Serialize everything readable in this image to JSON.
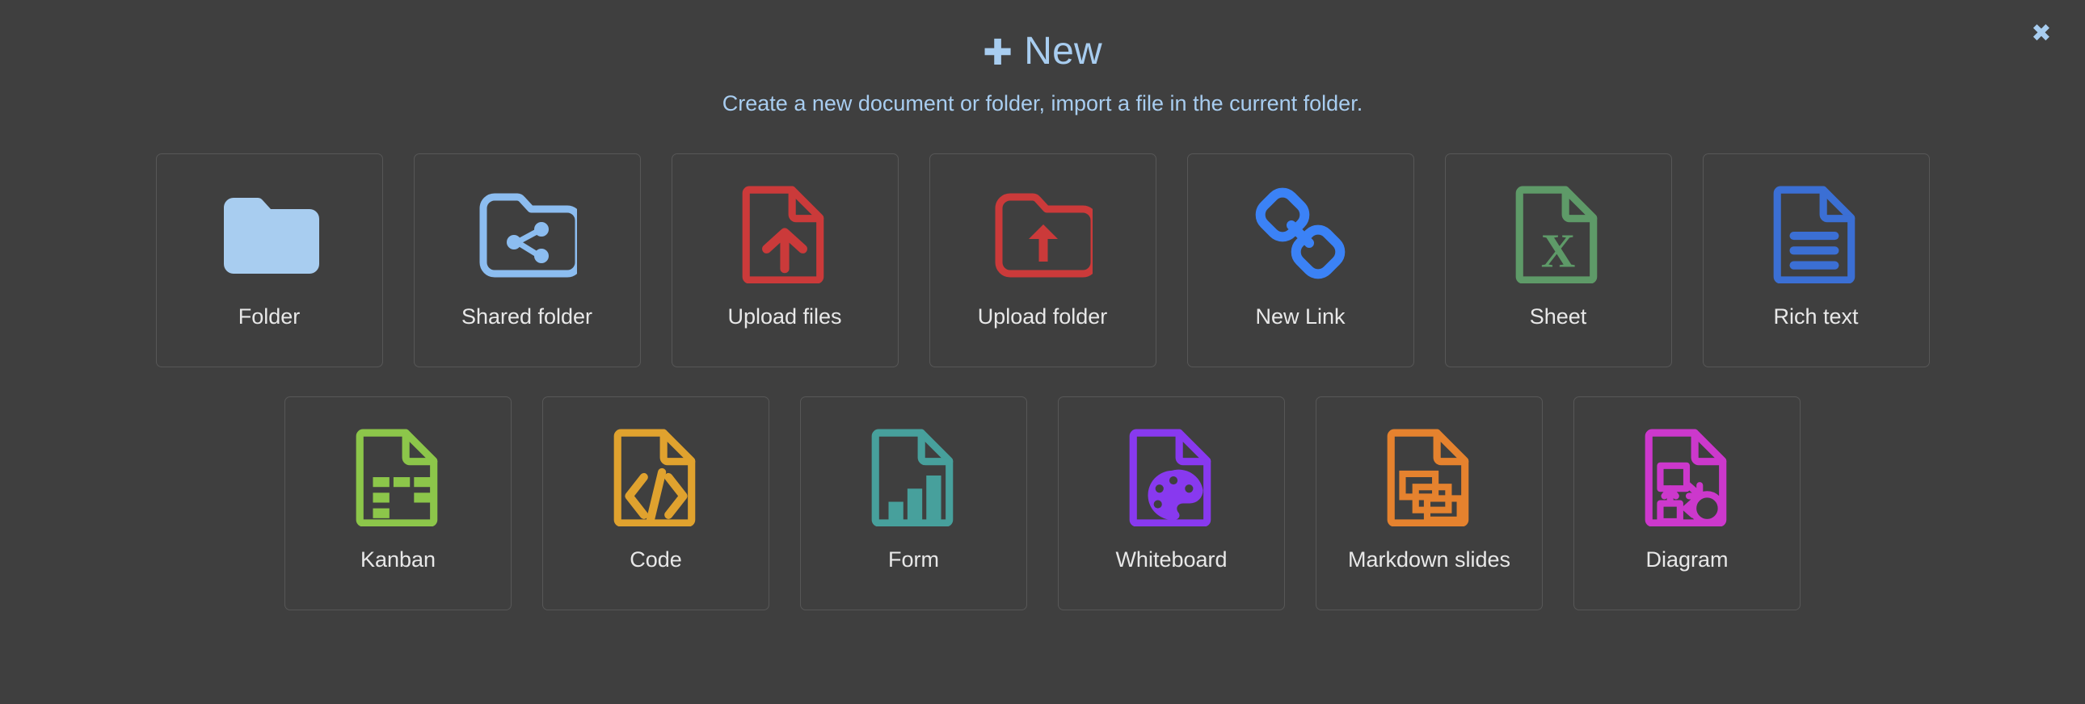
{
  "dialog": {
    "title": "New",
    "title_prefix_icon": "plus-icon",
    "subtitle": "Create a new document or folder, import a file in the current folder.",
    "close_icon": "close-icon",
    "close_label": "✖",
    "plus_glyph": "✚",
    "accent_color": "#a8cdf0",
    "background_color": "#3f3f3f",
    "tile_border_color": "#575757",
    "label_color": "#e8e8e8"
  },
  "rows": [
    {
      "name": "row-1",
      "tiles": [
        {
          "label": "Folder",
          "icon": "folder-icon",
          "color": "#a8cdf0"
        },
        {
          "label": "Shared folder",
          "icon": "shared-folder-icon",
          "color": "#8cbdf0"
        },
        {
          "label": "Upload files",
          "icon": "upload-file-icon",
          "color": "#cb3a3a"
        },
        {
          "label": "Upload folder",
          "icon": "upload-folder-icon",
          "color": "#cb3a3a"
        },
        {
          "label": "New Link",
          "icon": "link-icon",
          "color": "#3b82f6"
        },
        {
          "label": "Sheet",
          "icon": "sheet-icon",
          "color": "#5e9a68"
        },
        {
          "label": "Rich text",
          "icon": "rich-text-icon",
          "color": "#3b6fd4"
        }
      ]
    },
    {
      "name": "row-2",
      "tiles": [
        {
          "label": "Kanban",
          "icon": "kanban-icon",
          "color": "#8cc64a"
        },
        {
          "label": "Code",
          "icon": "code-icon",
          "color": "#e0a22e"
        },
        {
          "label": "Form",
          "icon": "form-icon",
          "color": "#47a09c"
        },
        {
          "label": "Whiteboard",
          "icon": "whiteboard-icon",
          "color": "#8839ef"
        },
        {
          "label": "Markdown slides",
          "icon": "slides-icon",
          "color": "#e5822e"
        },
        {
          "label": "Diagram",
          "icon": "diagram-icon",
          "color": "#cc38cc"
        }
      ]
    }
  ]
}
